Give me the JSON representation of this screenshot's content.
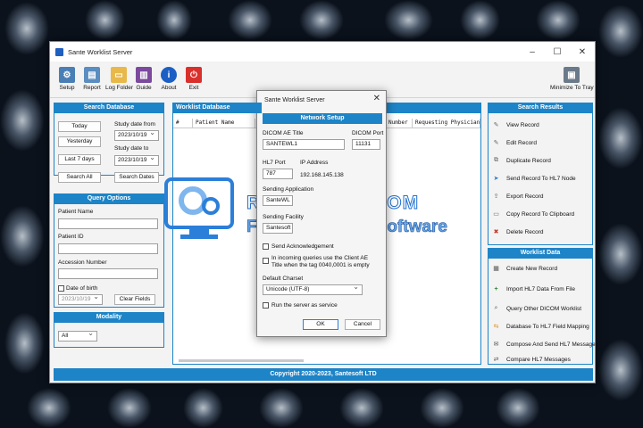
{
  "window": {
    "title": "Sante Worklist Server",
    "controls": {
      "minimize": "–",
      "maximize": "☐",
      "close": "✕"
    }
  },
  "toolbar": {
    "setup": "Setup",
    "report": "Report",
    "log_folder": "Log Folder",
    "guide": "Guide",
    "about": "About",
    "exit": "Exit",
    "minimize_tray": "Minimize To Tray"
  },
  "search_db": {
    "header": "Search Database",
    "today": "Today",
    "yesterday": "Yesterday",
    "last7": "Last 7 days",
    "search_all": "Search All",
    "study_from_label": "Study date from",
    "study_from_value": "2023/10/19",
    "study_to_label": "Study date to",
    "study_to_value": "2023/10/19",
    "search_dates": "Search Dates"
  },
  "query": {
    "header": "Query Options",
    "patient_name": "Patient Name",
    "patient_id": "Patient ID",
    "accession": "Accession Number",
    "dob": "Date of birth",
    "dob_value": "2023/10/19",
    "clear": "Clear Fields"
  },
  "modality": {
    "header": "Modality",
    "value": "All"
  },
  "worklist": {
    "header": "Worklist Database",
    "columns": [
      "#",
      "Patient Name",
      "Number",
      "Requesting Physician"
    ]
  },
  "search_results": {
    "header": "Search Results",
    "items": [
      "View Record",
      "Edit Record",
      "Duplicate Record",
      "Send Record To HL7 Node",
      "Export Record",
      "Copy Record To Clipboard",
      "Delete Record"
    ]
  },
  "worklist_data": {
    "header": "Worklist Data",
    "items": [
      "Create New Record",
      "Import HL7 Data From File",
      "Query Other DICOM Worklist",
      "Database To HL7 Field Mapping",
      "Compose And Send HL7 Message",
      "Compare HL7 Messages"
    ]
  },
  "footer": "Copyright 2020-2023, Santesoft LTD",
  "dialog": {
    "title": "Sante Worklist Server",
    "close": "✕",
    "header": "Network Setup",
    "ae_title_label": "DICOM AE Title",
    "ae_title_value": "SANTEWL1",
    "dicom_port_label": "DICOM Port",
    "dicom_port_value": "11131",
    "hl7_port_label": "HL7 Port",
    "hl7_port_value": "787",
    "ip_label": "IP Address",
    "ip_value": "192.168.145.138",
    "sending_app_label": "Sending Application",
    "sending_app_value": "SanteWL",
    "sending_fac_label": "Sending Facility",
    "sending_fac_value": "Santesoft",
    "send_ack": "Send Acknowledgement",
    "incoming_note": "In incoming queries use the Client AE Title when the tag 0040,0001 is empty",
    "charset_label": "Default Charset",
    "charset_value": "Unicode (UTF-8)",
    "run_service": "Run the server as service",
    "ok": "OK",
    "cancel": "Cancel"
  },
  "watermark": {
    "brand": "ROYALSOFT.COM",
    "tagline": "Full Version PC Software"
  },
  "colors": {
    "accent": "#1d84c7",
    "window_bg": "#f3f3f3"
  }
}
